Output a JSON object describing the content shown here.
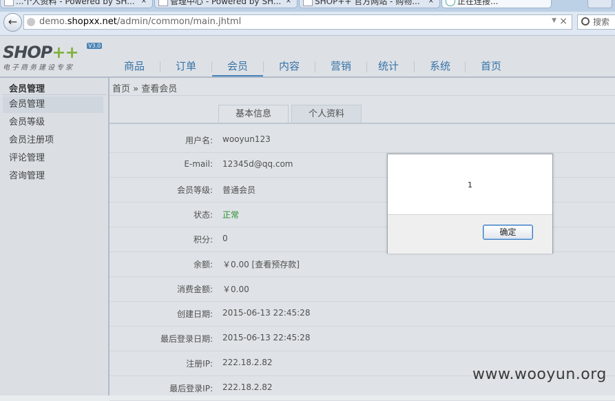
{
  "browser": {
    "tabs": [
      {
        "label": "...个人资料 - Powered by SH..."
      },
      {
        "label": "管理中心 - Powered by SH..."
      },
      {
        "label": "SHOP++ 官方网站 - 购物..."
      },
      {
        "label": "正在连接..."
      }
    ],
    "url_prefix": "demo.",
    "url_domain": "shopxx.net",
    "url_path": "/admin/common/main.jhtml",
    "search_placeholder": "搜索"
  },
  "header": {
    "logo_text": "SHOP",
    "logo_plus": "++",
    "logo_version": "V3.0",
    "logo_tagline": "电子商务建设专家",
    "menu": [
      {
        "label": "商品"
      },
      {
        "label": "订单"
      },
      {
        "label": "会员"
      },
      {
        "label": "内容"
      },
      {
        "label": "营销"
      },
      {
        "label": "统计"
      },
      {
        "label": "系统"
      },
      {
        "label": "首页"
      }
    ],
    "active_menu": "会员"
  },
  "sidebar": {
    "title": "会员管理",
    "items": [
      {
        "label": "会员管理"
      },
      {
        "label": "会员等级"
      },
      {
        "label": "会员注册项"
      },
      {
        "label": "评论管理"
      },
      {
        "label": "咨询管理"
      }
    ]
  },
  "content": {
    "breadcrumb": "首页 » 查看会员",
    "tabs": [
      {
        "label": "基本信息"
      },
      {
        "label": "个人资料"
      }
    ],
    "fields": [
      {
        "label": "用户名:",
        "value": "wooyun123"
      },
      {
        "label": "E-mail:",
        "value": "12345d@qq.com"
      },
      {
        "label": "会员等级:",
        "value": "普通会员"
      },
      {
        "label": "状态:",
        "value": "正常"
      },
      {
        "label": "积分:",
        "value": "0"
      },
      {
        "label": "余额:",
        "value": "￥0.00 [查看预存款]"
      },
      {
        "label": "消费金额:",
        "value": "￥0.00"
      },
      {
        "label": "创建日期:",
        "value": "2015-06-13 22:45:28"
      },
      {
        "label": "最后登录日期:",
        "value": "2015-06-13 22:45:28"
      },
      {
        "label": "注册IP:",
        "value": "222.18.2.82"
      },
      {
        "label": "最后登录IP:",
        "value": "222.18.2.82"
      }
    ]
  },
  "dialog": {
    "message": "1",
    "ok_label": "确定"
  },
  "watermark": "www.wooyun.org",
  "colors": {
    "menu_text": "#2b6da6",
    "status_ok": "#1d8b1d"
  }
}
